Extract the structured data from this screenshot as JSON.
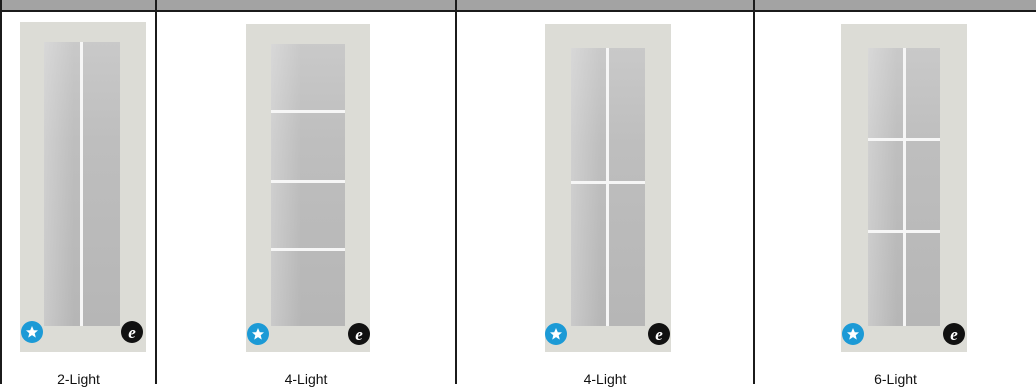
{
  "colors": {
    "header_bar": "#a3a3a3",
    "divider": "#1b1b1b",
    "star_badge": "#1c9ad6",
    "e_badge": "#111111"
  },
  "panels": [
    {
      "label": "2-Light",
      "badge_left_icon": "energy-star-icon",
      "badge_right_icon": "e-mark-icon",
      "badge_right_text": "e"
    },
    {
      "label": "4-Light",
      "badge_left_icon": "energy-star-icon",
      "badge_right_icon": "e-mark-icon",
      "badge_right_text": "e"
    },
    {
      "label": "4-Light",
      "badge_left_icon": "energy-star-icon",
      "badge_right_icon": "e-mark-icon",
      "badge_right_text": "e"
    },
    {
      "label": "6-Light",
      "badge_left_icon": "energy-star-icon",
      "badge_right_icon": "e-mark-icon",
      "badge_right_text": "e"
    }
  ]
}
